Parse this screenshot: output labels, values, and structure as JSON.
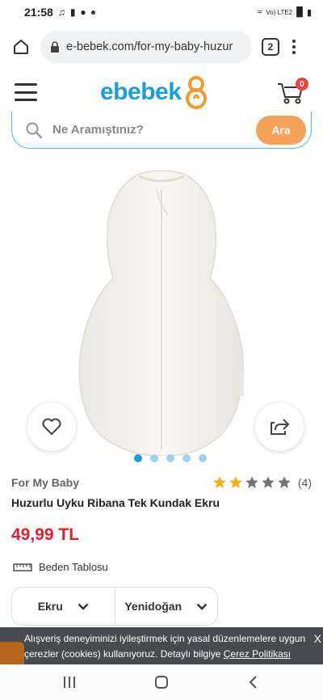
{
  "status_bar": {
    "time": "21:58",
    "network": "Vo) LTE2"
  },
  "browser": {
    "url": "e-bebek.com/for-my-baby-huzur",
    "tab_count": "2"
  },
  "header": {
    "logo_text": "ebebek",
    "cart_count": "0"
  },
  "search": {
    "placeholder": "Ne Aramıştınız?",
    "button_label": "Ara"
  },
  "gallery": {
    "image_count": 5,
    "active_index": 0
  },
  "product": {
    "brand": "For My Baby",
    "rating": {
      "value": 2,
      "max": 5,
      "count_label": "(4)"
    },
    "name": "Huzurlu Uyku Ribana Tek Kundak Ekru",
    "price": "49,99 TL",
    "size_table_label": "Beden Tablosu",
    "color_select": "Ekru",
    "size_select": "Yenidoğan"
  },
  "cookie_banner": {
    "text_line1": "Alışveriş deneyiminizi iyileştirmek için yasal düzenlemelere uygun",
    "text_line2": "çerezler (cookies) kullanıyoruz. Detaylı bilgiye ",
    "link": "Çerez Politikası",
    "close": "X"
  },
  "colors": {
    "brand_blue": "#1a9ed9",
    "search_button": "#f5a25a",
    "price_red": "#e0202d",
    "star_filled": "#f2b01e",
    "star_empty": "#777777",
    "cart_badge": "#e8433d"
  },
  "icons": [
    "home-icon",
    "lock-icon",
    "menu-icon",
    "hamburger-icon",
    "cart-icon",
    "search-icon",
    "heart-icon",
    "share-icon",
    "star-icon",
    "ruler-icon",
    "chevron-down-icon"
  ]
}
